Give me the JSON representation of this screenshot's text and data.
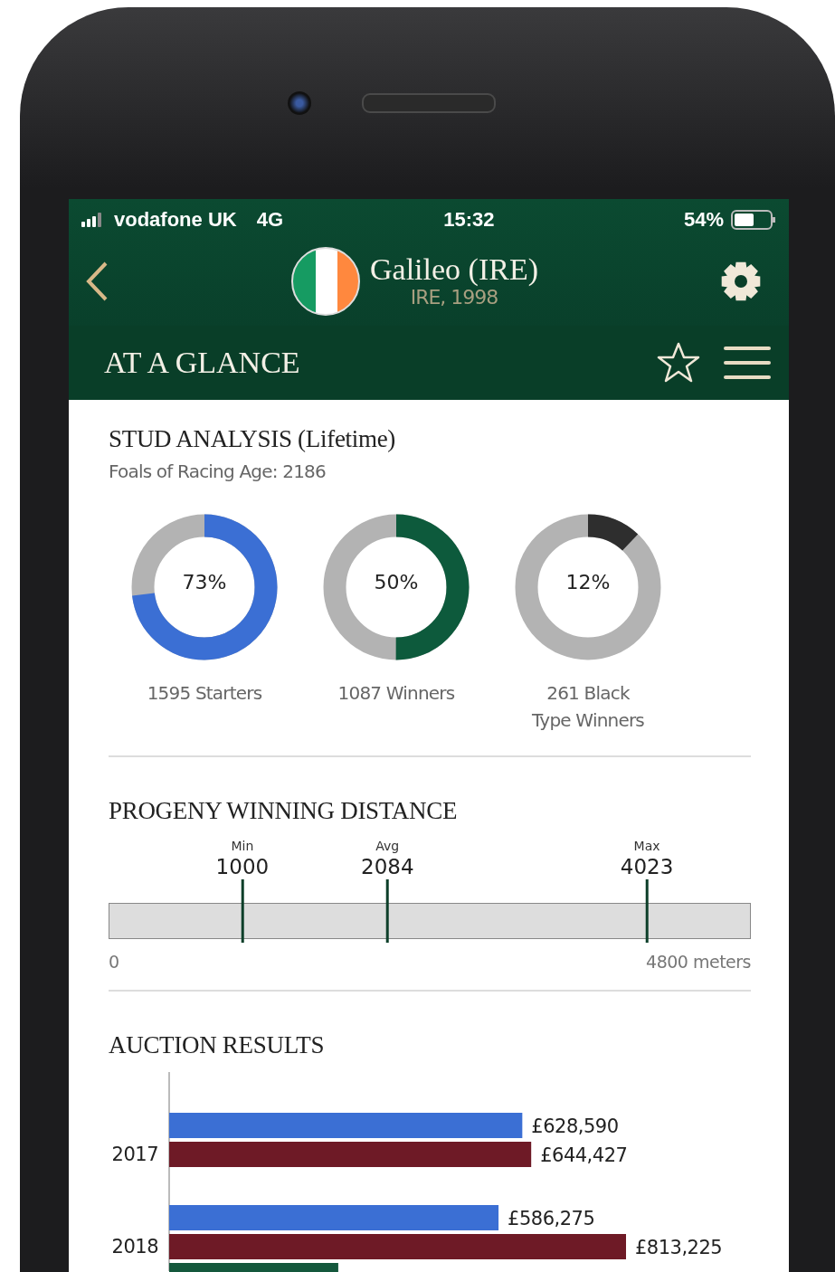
{
  "status_bar": {
    "carrier": "vodafone UK",
    "network": "4G",
    "time": "15:32",
    "battery": "54%"
  },
  "header": {
    "back": true,
    "title": "Galileo (IRE)",
    "subtitle": "IRE, 1998"
  },
  "section_bar": {
    "title": "AT A GLANCE",
    "favorite": false
  },
  "stud_analysis": {
    "title": "STUD ANALYSIS (Lifetime)",
    "subtitle": "Foals of Racing Age: 2186",
    "donuts": [
      {
        "value": "73%",
        "level": 0.73,
        "color": "#3b6fd4",
        "label": "1595 Starters"
      },
      {
        "value": "50%",
        "level": 0.5,
        "color": "#0d5a3c",
        "label": "1087 Winners"
      },
      {
        "value": "12%",
        "level": 0.12,
        "color": "#2e2e2e",
        "label": "261 Black Type Winners"
      }
    ]
  },
  "progeny_distance": {
    "title": "PROGENY WINNING DISTANCE",
    "markers": [
      {
        "caption": "Min",
        "value": "1000",
        "level": 0.2083
      },
      {
        "caption": "Avg",
        "value": "2084",
        "level": 0.4342
      },
      {
        "caption": "Max",
        "value": "4023",
        "level": 0.8381
      }
    ],
    "scale_start": "0",
    "scale_end": "4800 meters"
  },
  "auction_results": {
    "title": "AUCTION RESULTS",
    "chart_data": {
      "type": "bar",
      "orientation": "horizontal",
      "categories": [
        "2017",
        "2018"
      ],
      "series": [
        {
          "color": "#3b6fd4",
          "values": [
            628590,
            586275
          ],
          "value_labels": [
            "£628,590",
            "£586,275"
          ]
        },
        {
          "color": "#6e1a26",
          "values": [
            644427,
            813225
          ],
          "value_labels": [
            "£644,427",
            "£813,225"
          ]
        },
        {
          "color": "#14583c",
          "values": [
            null,
            301000
          ],
          "value_labels": [
            null,
            null
          ]
        }
      ]
    }
  }
}
